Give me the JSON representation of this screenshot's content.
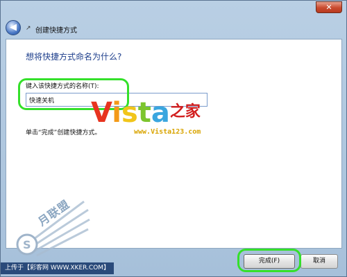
{
  "window": {
    "close_label": "✕"
  },
  "titlebar": {
    "title": "创建快捷方式",
    "back_icon": "back-arrow-icon"
  },
  "main": {
    "heading": "想将快捷方式命名为什么?",
    "field_label": "键入该快捷方式的名称(T):",
    "field_value": "快速关机",
    "hint": "单击“完成”创建快捷方式。"
  },
  "watermark": {
    "logo_v": "V",
    "logo_i": "i",
    "logo_s": "s",
    "logo_t": "t",
    "logo_a": "a",
    "logo_cn": "之家",
    "url": "www.Vista123.com",
    "wing_text": "月联盟"
  },
  "footer": {
    "finish_label": "完成(F)",
    "cancel_label": "取消",
    "upload_text": "上传于【彩客网 WWW.XKER.COM】"
  },
  "colors": {
    "highlight": "#34e02a",
    "heading": "#1e3f8c"
  }
}
